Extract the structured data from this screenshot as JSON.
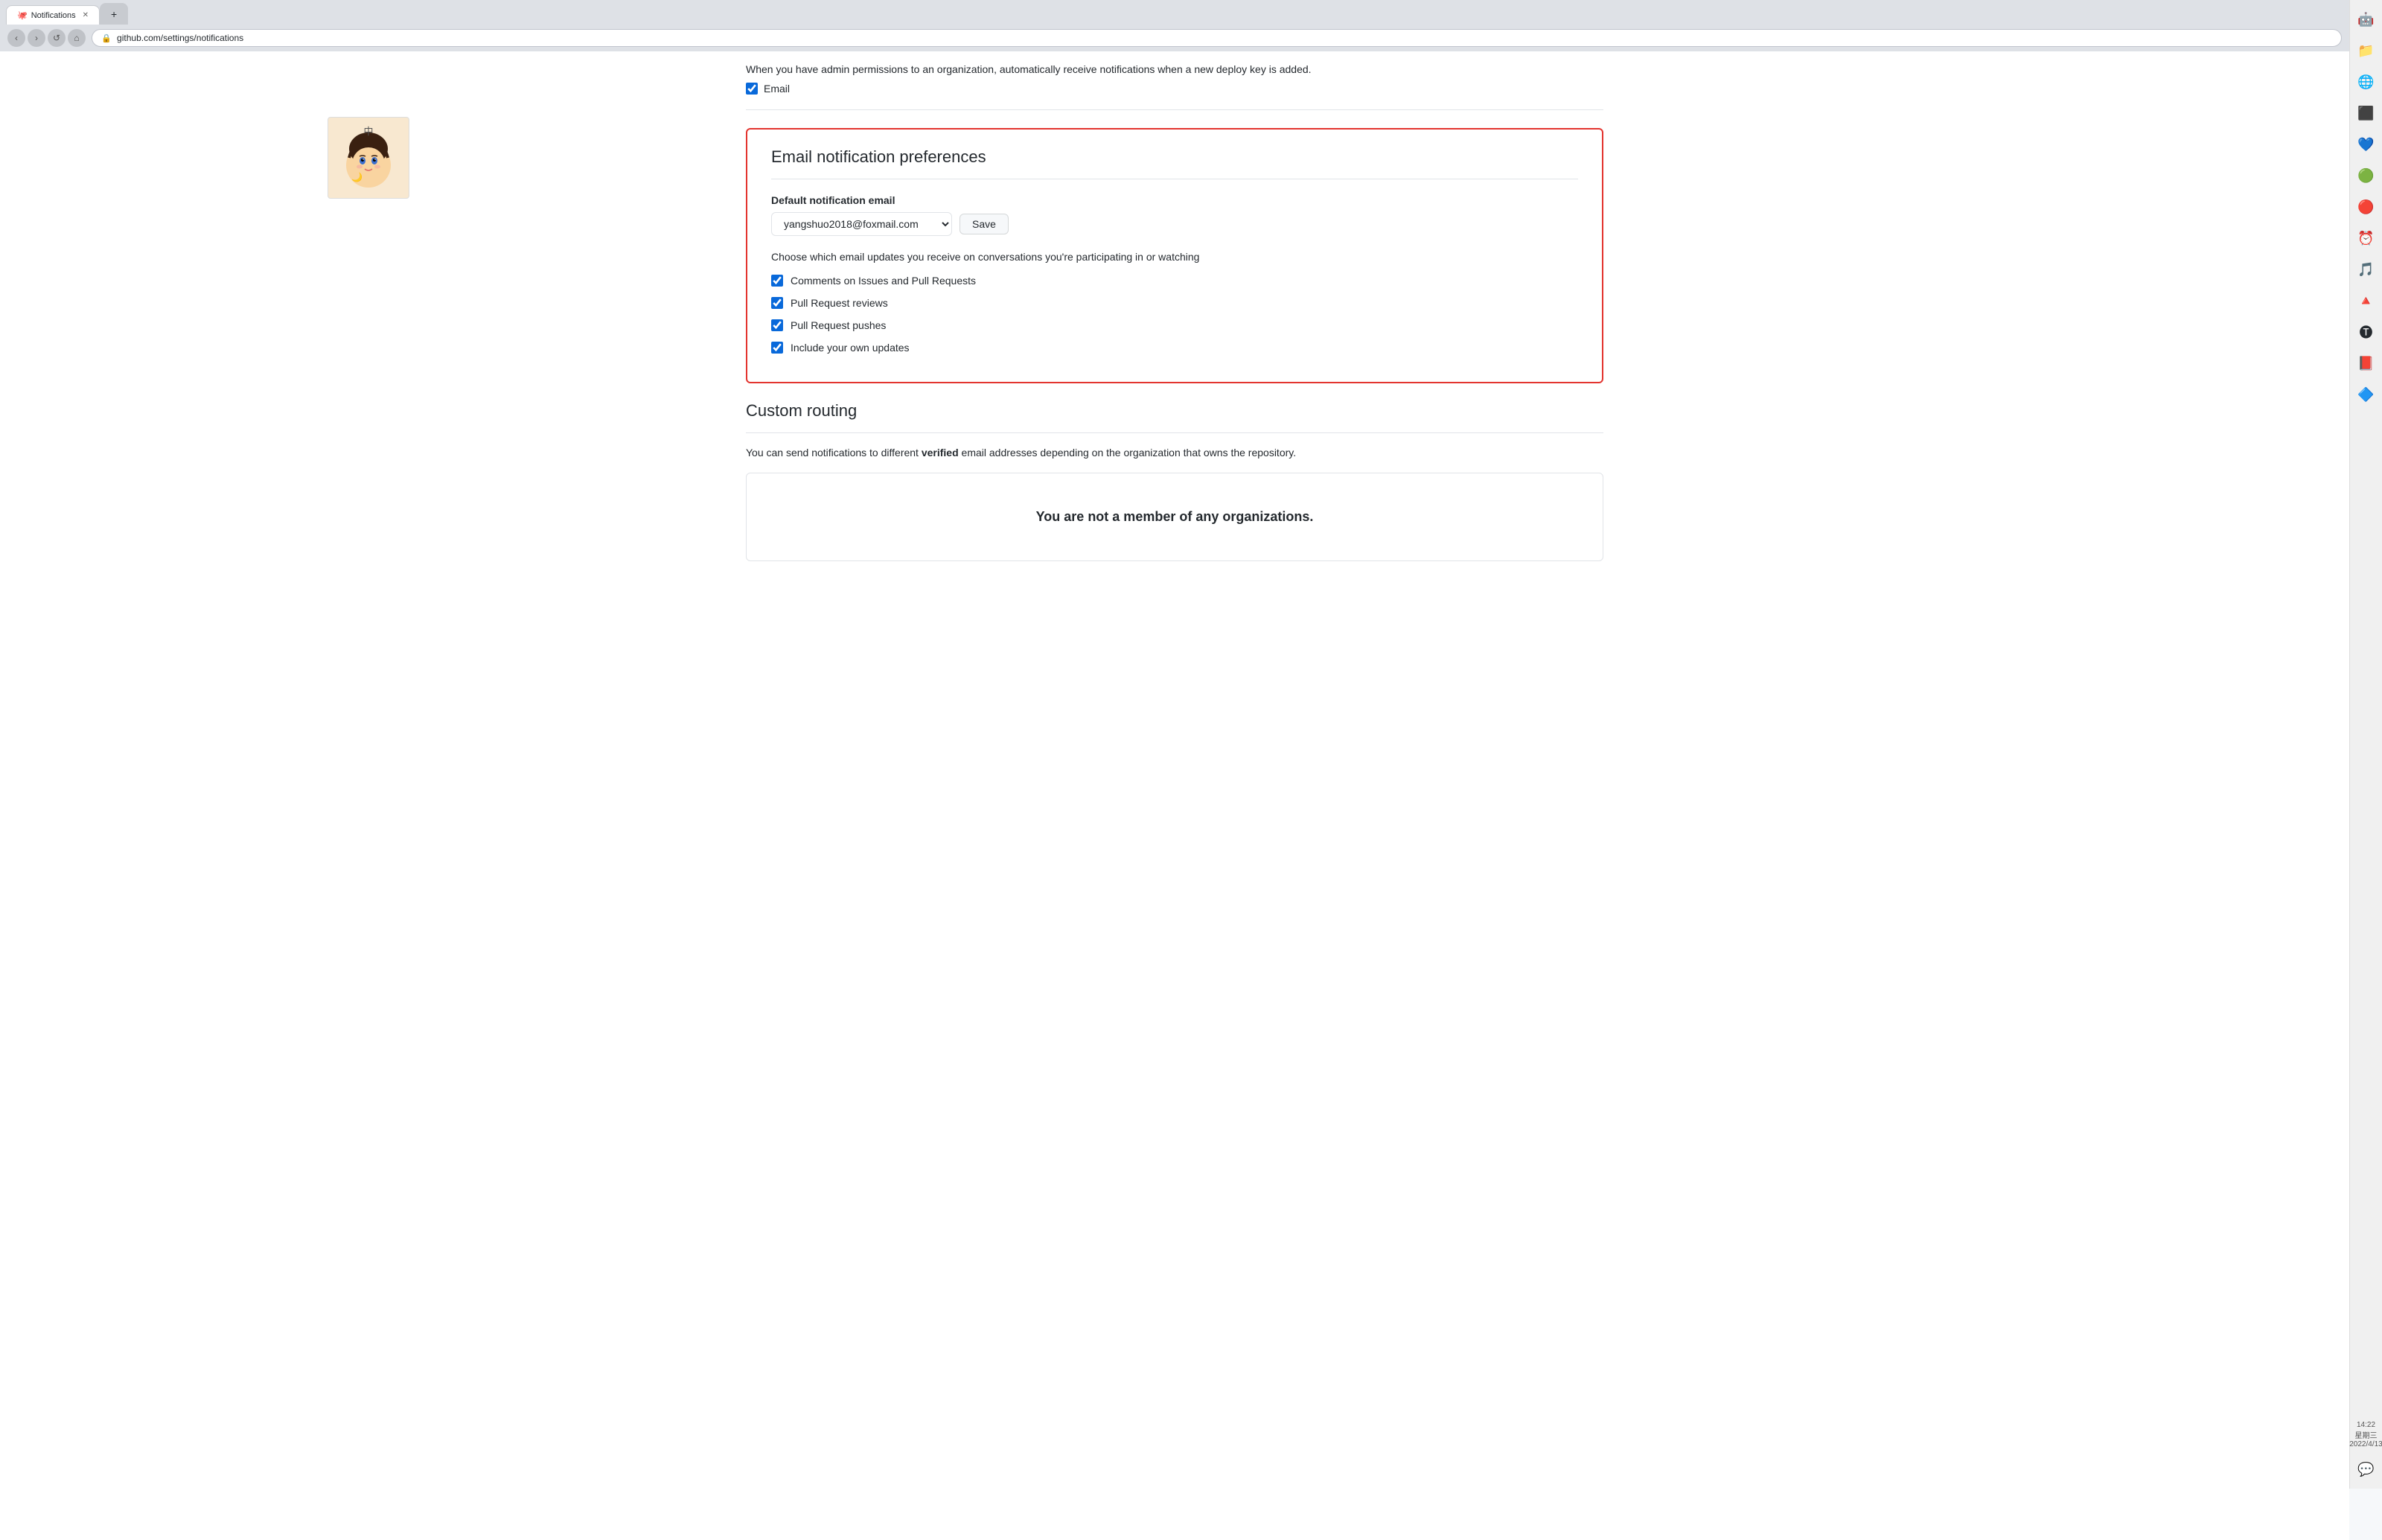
{
  "browser": {
    "url": "github.com/settings/notifications",
    "tab_label": "Notifications",
    "tab_favicon": "🐙"
  },
  "deploy_key": {
    "description": "When you have admin permissions to an organization, automatically receive notifications when a new deploy key is added.",
    "email_label": "Email"
  },
  "email_prefs": {
    "section_title": "Email notification preferences",
    "default_email_label": "Default notification email",
    "email_value": "yangshuo2018@foxmail.com",
    "save_button": "Save",
    "choose_text": "Choose which email updates you receive on conversations you're participating in or watching",
    "checkboxes": [
      {
        "id": "cb1",
        "label": "Comments on Issues and Pull Requests",
        "checked": true
      },
      {
        "id": "cb2",
        "label": "Pull Request reviews",
        "checked": true
      },
      {
        "id": "cb3",
        "label": "Pull Request pushes",
        "checked": true
      },
      {
        "id": "cb4",
        "label": "Include your own updates",
        "checked": true
      }
    ]
  },
  "custom_routing": {
    "section_title": "Custom routing",
    "description_before": "You can send notifications to different ",
    "description_bold": "verified",
    "description_after": " email addresses depending on the organization that owns the repository.",
    "empty_message": "You are not a member of any organizations."
  },
  "popup": {
    "label": "中"
  }
}
